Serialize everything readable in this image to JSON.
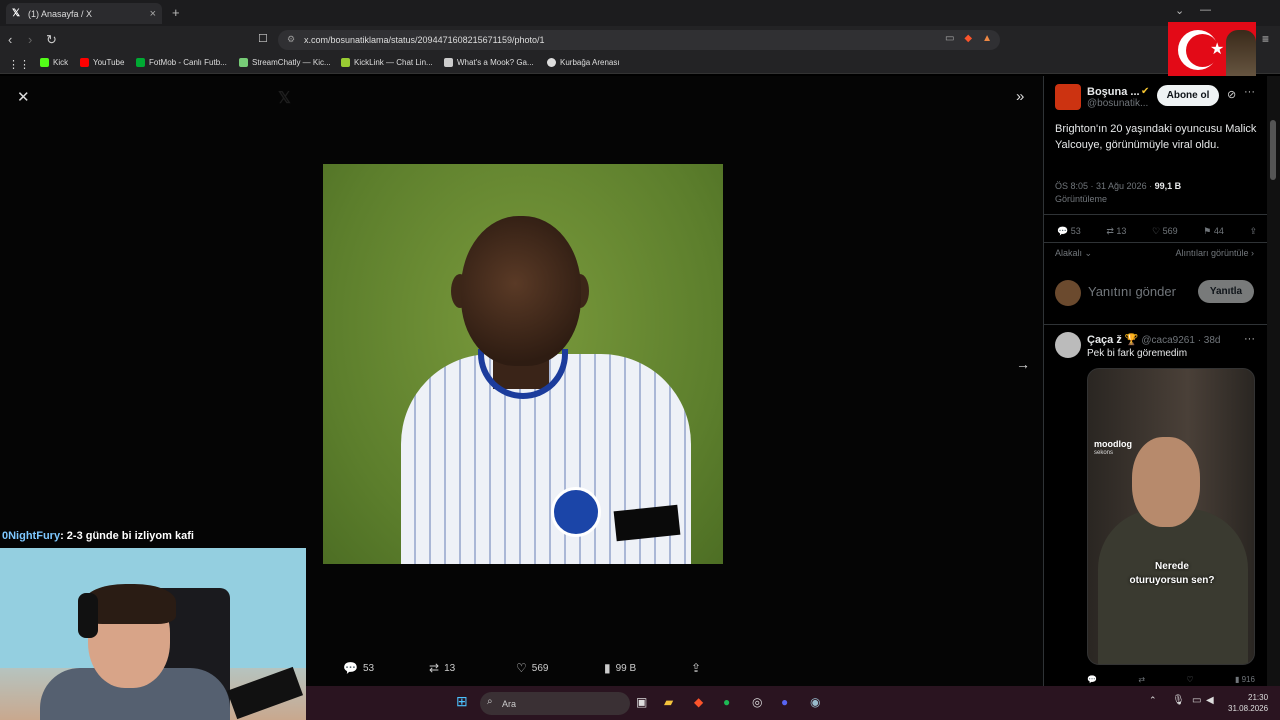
{
  "browser": {
    "tab_title": "(1) Anasayfa / X",
    "url": "x.com/bosunatiklama/status/2094471608215671159/photo/1",
    "bookmarks": [
      "Kick",
      "YouTube",
      "FotMob - Canlı Futb...",
      "StreamChatly — Kic...",
      "KickLink — Chat Lin...",
      "What's a Mook? Ga...",
      "Kurbağa Arenası"
    ]
  },
  "viewer": {
    "actions": {
      "replies": "53",
      "reposts": "13",
      "likes": "569",
      "views": "99 B"
    }
  },
  "chat": {
    "user": "0NightFury",
    "message": ": 2-3 günde bi izliyom kafi"
  },
  "side": {
    "author_name": "Boşuna ...",
    "author_handle": "@bosunatik...",
    "follow_label": "Abone ol",
    "tweet_text": "Brighton'ın 20 yaşındaki oyuncusu Malick Yalcouye, görünümüyle viral oldu.",
    "time": "ÖS 8:05 · 31 Ağu 2026 · ",
    "views_count": "99,1 B",
    "views_label": "Görüntüleme",
    "stats": {
      "replies": "53",
      "reposts": "13",
      "likes": "569",
      "bookmarks": "44"
    },
    "relevance": "Alakalı",
    "quotes_link": "Alıntıları görüntüle",
    "reply_placeholder": "Yanıtını gönder",
    "reply_button": "Yanıtla",
    "reply": {
      "name": "Çaça ž 🏆",
      "handle": "@caca9261 · 38d",
      "text": "Pek bi fark göremedim",
      "video_logo": "moodlog",
      "video_sub": "sekons",
      "video_caption_1": "Nerede",
      "video_caption_2": "oturuyorsun sen?",
      "views": "916"
    }
  },
  "taskbar": {
    "search": "Ara",
    "time": "21:30",
    "date": "31.08.2026"
  }
}
